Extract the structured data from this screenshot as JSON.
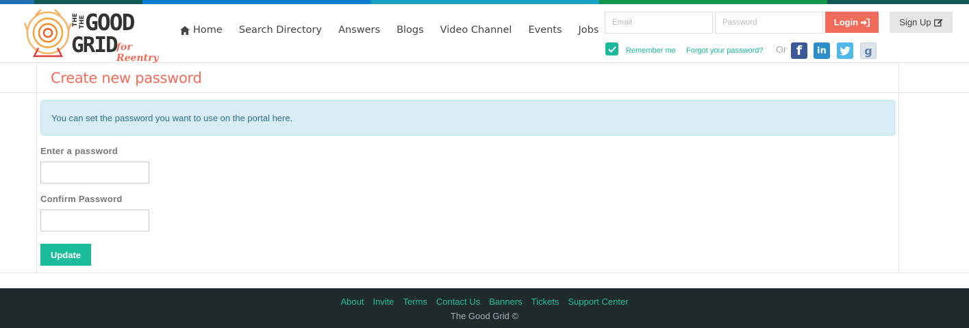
{
  "colors": {
    "strip": [
      "#1f6fb4",
      "#0a7fd0",
      "#12a3c4",
      "#14964b",
      "#0f5a55"
    ],
    "accent": "#f26b5b",
    "teal": "#1abc9c",
    "footer_bg": "#1f2b2b"
  },
  "logo": {
    "line1_small": "THE",
    "line1": "GOOD",
    "line2": "GRID",
    "tagline": "for Reentry"
  },
  "nav": {
    "items": [
      {
        "label": "Home",
        "icon": "home-icon"
      },
      {
        "label": "Search Directory"
      },
      {
        "label": "Answers"
      },
      {
        "label": "Blogs"
      },
      {
        "label": "Video Channel"
      },
      {
        "label": "Events"
      },
      {
        "label": "Jobs"
      }
    ]
  },
  "login": {
    "email_placeholder": "Email",
    "password_placeholder": "Password",
    "login_label": "Login",
    "signup_label": "Sign Up",
    "remember_label": "Remember me",
    "remember_checked": true,
    "forgot_label": "Forgot your password?",
    "or_label": "Or",
    "social": [
      "facebook-icon",
      "linkedin-icon",
      "twitter-icon",
      "google-icon"
    ]
  },
  "page": {
    "title": "Create new password",
    "info": "You can set the password you want to use on the portal here.",
    "password_label": "Enter a password",
    "confirm_label": "Confirm Password",
    "update_label": "Update"
  },
  "footer": {
    "links": [
      "About",
      "Invite",
      "Terms",
      "Contact Us",
      "Banners",
      "Tickets",
      "Support Center"
    ],
    "copyright": "The Good Grid ©"
  }
}
